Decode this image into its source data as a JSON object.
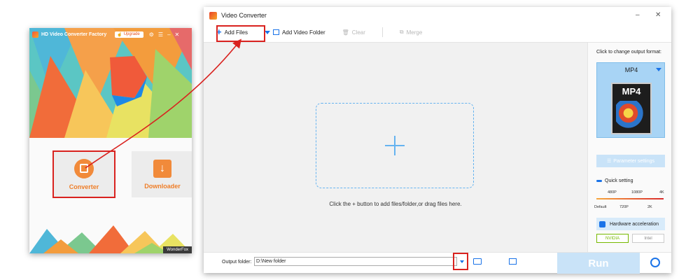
{
  "left_app": {
    "title": "HD Video Converter Factory",
    "upgrade_label": "Upgrade",
    "converter_label": "Converter",
    "downloader_label": "Downloader",
    "brand": "WonderFox"
  },
  "right_app": {
    "title": "Video Converter",
    "toolbar": {
      "add_files": "Add Files",
      "add_video_folder": "Add Video Folder",
      "clear": "Clear",
      "merge": "Merge"
    },
    "drop_hint": "Click the + button to add files/folder,or drag files here.",
    "side": {
      "format_hint": "Click to change output format:",
      "format": "MP4",
      "format_badge": "MP4",
      "parameter_settings": "Parameter settings",
      "quick_setting": "Quick setting",
      "scale_top": [
        "480P",
        "1080P",
        "4K"
      ],
      "scale_bottom": [
        "Default",
        "720P",
        "2K"
      ],
      "hardware_acceleration": "Hardware acceleration",
      "nvidia": "NVIDIA",
      "intel": "Intel"
    },
    "bottom": {
      "output_folder_label": "Output folder:",
      "output_folder_value": "D:\\New folder",
      "run_label": "Run"
    }
  },
  "colors": {
    "accent": "#1a73e8",
    "highlight": "#d9221f",
    "orange": "#ef7e28"
  }
}
